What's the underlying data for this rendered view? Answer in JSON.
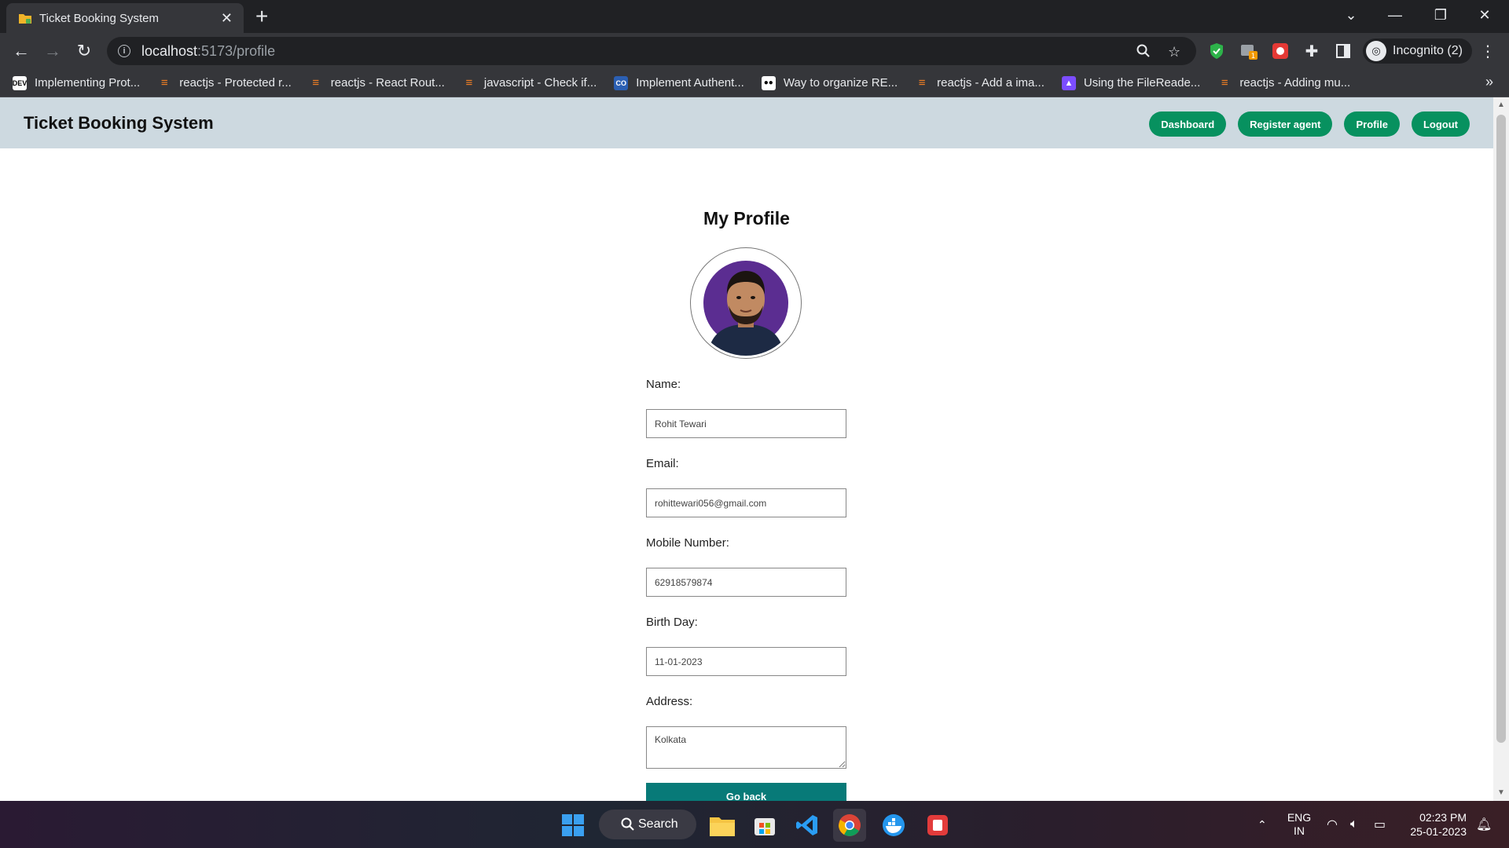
{
  "browser": {
    "tab_title": "Ticket Booking System",
    "url_host": "localhost",
    "url_path": ":5173/profile",
    "incognito_label": "Incognito (2)",
    "bookmarks": [
      {
        "label": "Implementing Prot...",
        "icon": "dev-icon"
      },
      {
        "label": "reactjs - Protected r...",
        "icon": "stackoverflow-icon"
      },
      {
        "label": "reactjs - React Rout...",
        "icon": "stackoverflow-icon"
      },
      {
        "label": "javascript - Check if...",
        "icon": "stackoverflow-icon"
      },
      {
        "label": "Implement Authent...",
        "icon": "co-icon"
      },
      {
        "label": "Way to organize RE...",
        "icon": "medium-icon"
      },
      {
        "label": "reactjs - Add a ima...",
        "icon": "stackoverflow-icon"
      },
      {
        "label": "Using the FileReade...",
        "icon": "rocket-icon"
      },
      {
        "label": "reactjs - Adding mu...",
        "icon": "stackoverflow-icon"
      }
    ]
  },
  "app": {
    "brand": "Ticket Booking System",
    "nav": [
      "Dashboard",
      "Register agent",
      "Profile",
      "Logout"
    ]
  },
  "profile": {
    "title": "My Profile",
    "fields": {
      "name_label": "Name:",
      "name_value": "Rohit Tewari",
      "email_label": "Email:",
      "email_value": "rohittewari056@gmail.com",
      "mobile_label": "Mobile Number:",
      "mobile_value": "62918579874",
      "birthday_label": "Birth Day:",
      "birthday_value": "11-01-2023",
      "address_label": "Address:",
      "address_value": "Kolkata"
    },
    "go_back_label": "Go back"
  },
  "taskbar": {
    "search_label": "Search",
    "lang_line1": "ENG",
    "lang_line2": "IN",
    "time": "02:23 PM",
    "date": "25-01-2023"
  },
  "colors": {
    "nav_pill": "#07915f",
    "go_back": "#087a78",
    "navbar_bg": "#cdd9e0"
  }
}
